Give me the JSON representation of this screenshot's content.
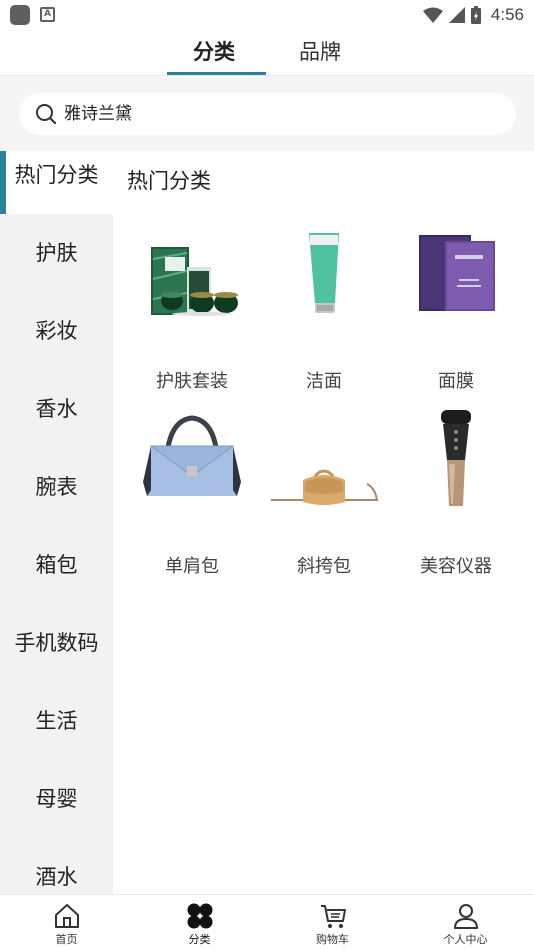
{
  "status_bar": {
    "time": "4:56"
  },
  "top_tabs": [
    {
      "label": "分类",
      "active": true
    },
    {
      "label": "品牌",
      "active": false
    }
  ],
  "search": {
    "value": "雅诗兰黛"
  },
  "sidebar": {
    "items": [
      {
        "label": "热门分类",
        "active": true
      },
      {
        "label": "护肤"
      },
      {
        "label": "彩妆"
      },
      {
        "label": "香水"
      },
      {
        "label": "腕表"
      },
      {
        "label": "箱包"
      },
      {
        "label": "手机数码"
      },
      {
        "label": "生活"
      },
      {
        "label": "母婴"
      },
      {
        "label": "酒水"
      }
    ]
  },
  "content": {
    "section_title": "热门分类",
    "products": [
      {
        "label": "护肤套装",
        "icon": "skincare-set-image"
      },
      {
        "label": "洁面",
        "icon": "cleanser-tube-image"
      },
      {
        "label": "面膜",
        "icon": "face-mask-box-image"
      },
      {
        "label": "单肩包",
        "icon": "shoulder-bag-image"
      },
      {
        "label": "斜挎包",
        "icon": "crossbody-bag-image"
      },
      {
        "label": "美容仪器",
        "icon": "beauty-device-image"
      }
    ]
  },
  "bottom_nav": [
    {
      "label": "首页",
      "icon": "home-icon"
    },
    {
      "label": "分类",
      "icon": "category-icon",
      "active": true
    },
    {
      "label": "购物车",
      "icon": "cart-icon"
    },
    {
      "label": "个人中心",
      "icon": "user-icon"
    }
  ],
  "colors": {
    "accent": "#2b8397",
    "sidebar_bg": "#f2f2f2",
    "search_bg": "#f5f5f5"
  }
}
